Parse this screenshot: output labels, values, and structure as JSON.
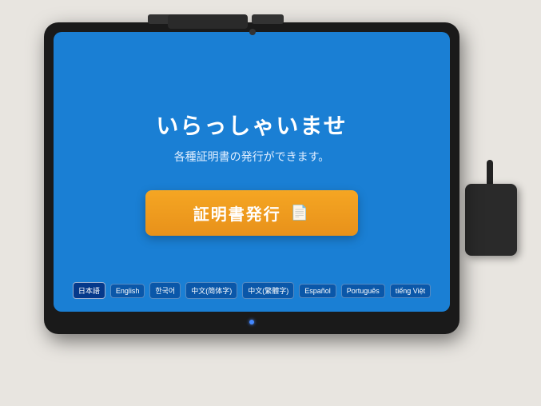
{
  "scene": {
    "wall_color": "#f0eeea",
    "desk_color": "#e8e5e0"
  },
  "screen": {
    "background_color": "#1a7fd4",
    "title": "いらっしゃいませ",
    "subtitle": "各種証明書の発行ができます。",
    "main_button_label": "証明書発行",
    "main_button_color": "#f5a623"
  },
  "languages": [
    {
      "label": "日本語",
      "active": true
    },
    {
      "label": "English",
      "active": false
    },
    {
      "label": "한국어",
      "active": false
    },
    {
      "label": "中文(简体字)",
      "active": false
    },
    {
      "label": "中文(繁體字)",
      "active": false
    },
    {
      "label": "Español",
      "active": false
    },
    {
      "label": "Português",
      "active": false
    },
    {
      "label": "tiếng Việt",
      "active": false
    }
  ]
}
